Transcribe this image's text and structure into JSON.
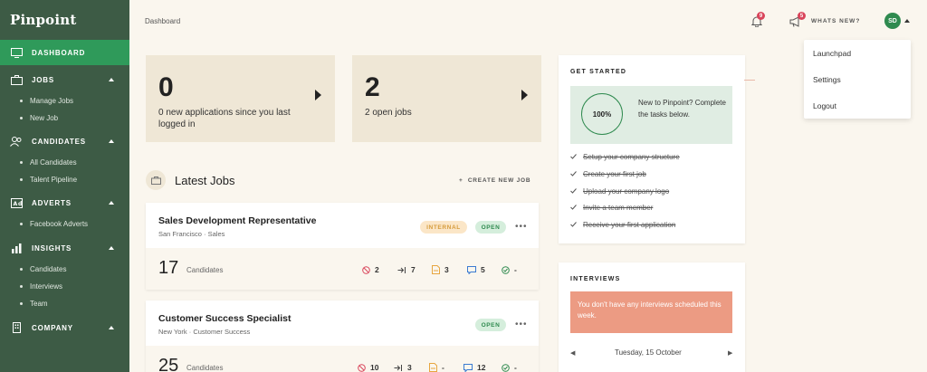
{
  "sidebar": {
    "brand": "Pinpoint",
    "sections": [
      {
        "label": "DASHBOARD",
        "icon": "monitor-icon"
      },
      {
        "label": "JOBS",
        "icon": "briefcase-icon",
        "items": [
          "Manage Jobs",
          "New Job"
        ]
      },
      {
        "label": "CANDIDATES",
        "icon": "people-icon",
        "items": [
          "All Candidates",
          "Talent Pipeline"
        ]
      },
      {
        "label": "ADVERTS",
        "icon": "ad-icon",
        "items": [
          "Facebook Adverts"
        ]
      },
      {
        "label": "INSIGHTS",
        "icon": "chart-icon",
        "items": [
          "Candidates",
          "Interviews",
          "Team"
        ]
      },
      {
        "label": "COMPANY",
        "icon": "building-icon"
      }
    ]
  },
  "header": {
    "breadcrumb": "Dashboard",
    "notifications_count": "9",
    "whats_new_count": "5",
    "whats_new_label": "WHATS NEW?",
    "avatar_initials": "SD"
  },
  "user_menu": [
    "Launchpad",
    "Settings",
    "Logout"
  ],
  "stats": [
    {
      "value": "0",
      "description": "0 new applications since you last logged in"
    },
    {
      "value": "2",
      "description": "2 open jobs"
    }
  ],
  "latest_jobs": {
    "title": "Latest Jobs",
    "create_label": "CREATE NEW JOB",
    "jobs": [
      {
        "title": "Sales Development Representative",
        "location": "San Francisco · Sales",
        "tags": [
          "INTERNAL",
          "OPEN"
        ],
        "candidates": "17",
        "candidates_label": "Candidates",
        "metrics": {
          "rejected": "2",
          "moved": "7",
          "documents": "3",
          "messages": "5",
          "hired": "-"
        }
      },
      {
        "title": "Customer Success Specialist",
        "location": "New York · Customer Success",
        "tags": [
          "OPEN"
        ],
        "candidates": "25",
        "candidates_label": "Candidates",
        "metrics": {
          "rejected": "10",
          "moved": "3",
          "documents": "-",
          "messages": "12",
          "hired": "-"
        }
      }
    ]
  },
  "get_started": {
    "title": "GET STARTED",
    "progress": "100%",
    "message": "New to Pinpoint? Complete the tasks below.",
    "tasks": [
      "Setup your company structure",
      "Create your first job",
      "Upload your company logo",
      "Invite a team member",
      "Receive your first application"
    ]
  },
  "interviews": {
    "title": "INTERVIEWS",
    "alert": "You don't have any interviews scheduled this week.",
    "date": "Tuesday, 15 October"
  },
  "colors": {
    "sidebar": "#3d5b45",
    "active": "#2f9a5a",
    "card": "#efe7d6",
    "alert": "#ec9b83"
  }
}
